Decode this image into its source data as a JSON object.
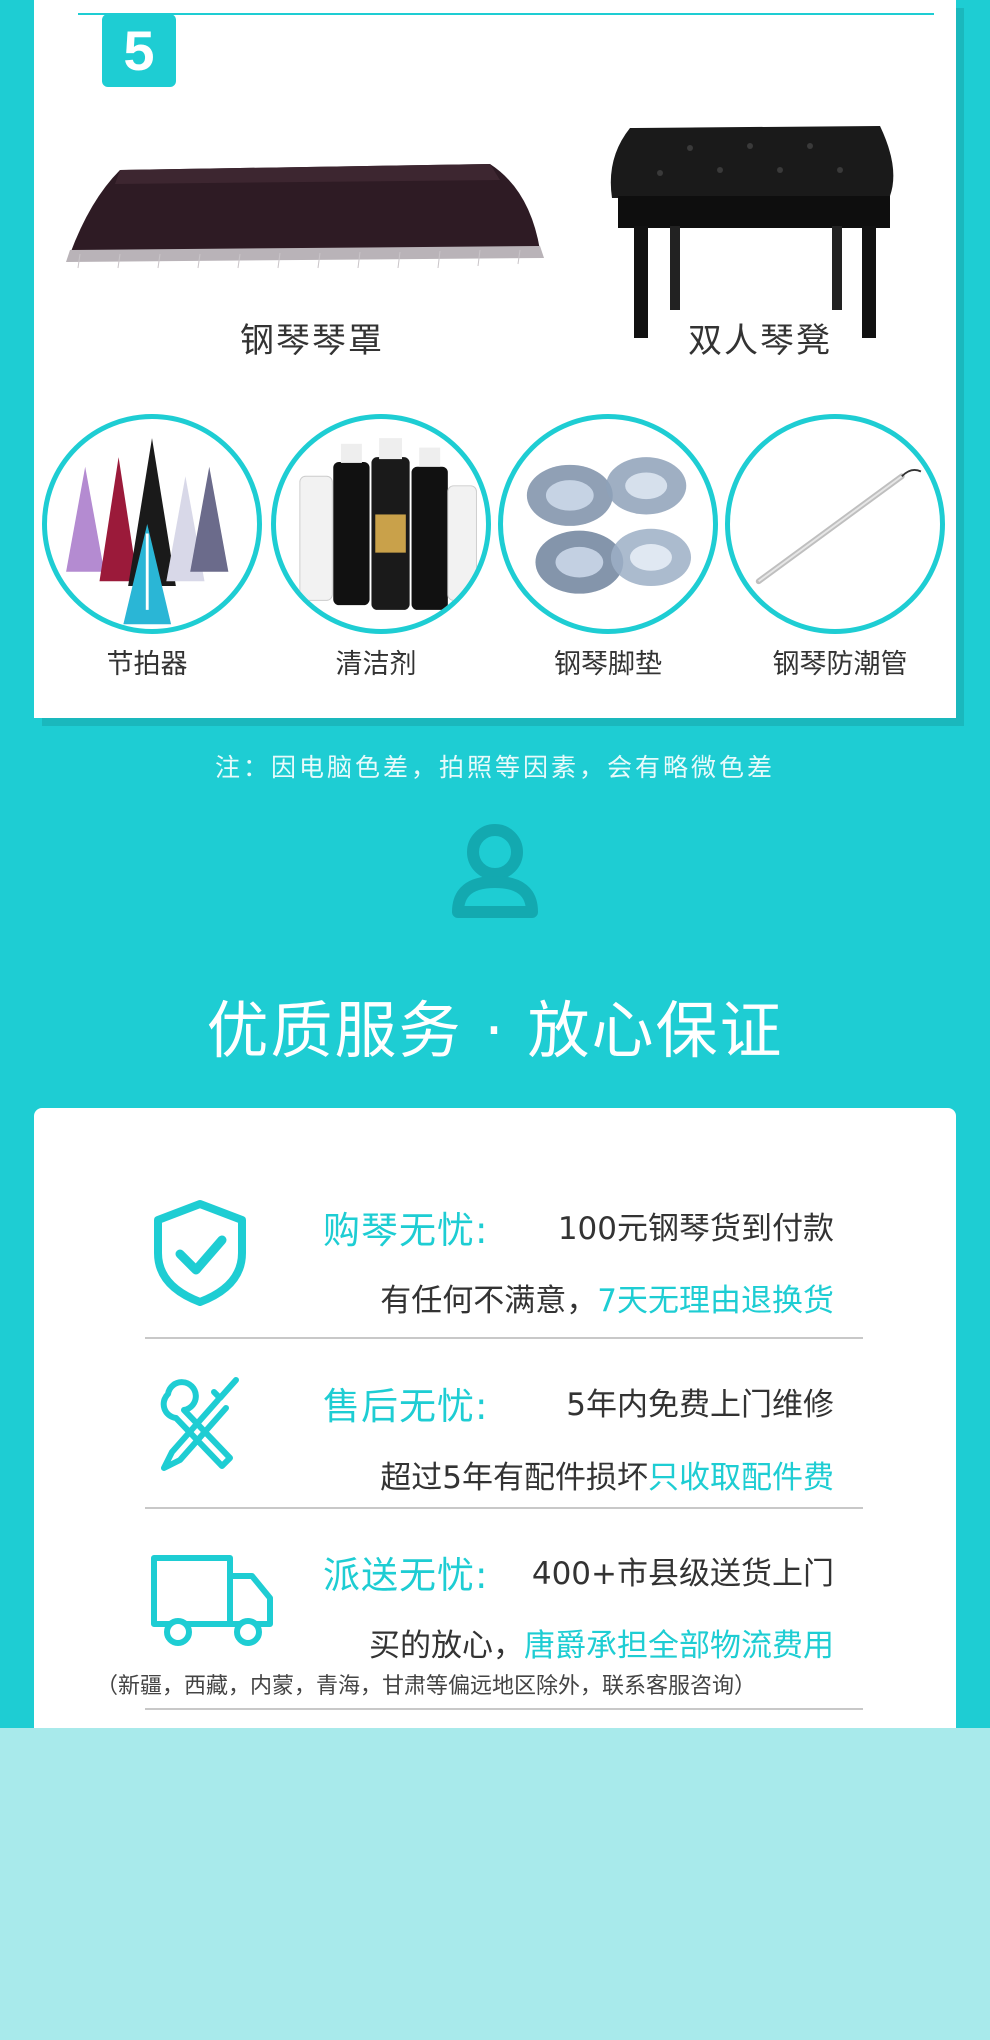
{
  "section_number": "5",
  "products": [
    {
      "label": "钢琴琴罩"
    },
    {
      "label": "双人琴凳"
    }
  ],
  "accessories": [
    {
      "label": "节拍器"
    },
    {
      "label": "清洁剂"
    },
    {
      "label": "钢琴脚垫"
    },
    {
      "label": "钢琴防潮管"
    }
  ],
  "note": "注：因电脑色差，拍照等因素，会有略微色差",
  "heading": "优质服务 · 放心保证",
  "services": [
    {
      "title": "购琴无忧:",
      "line1": "100元钢琴货到付款",
      "line2_plain": "有任何不满意，",
      "line2_highlight": "7天无理由退换货"
    },
    {
      "title": "售后无忧:",
      "line1": "5年内免费上门维修",
      "line2_plain": "超过5年有配件损坏",
      "line2_highlight": "只收取配件费"
    },
    {
      "title": "派送无忧:",
      "line1": "400+市县级送货上门",
      "line2_plain": "买的放心，",
      "line2_highlight": "唐爵承担全部物流费用"
    }
  ],
  "delivery_note": "（新疆，西藏，内蒙，青海，甘肃等偏远地区除外，联系客服咨询）",
  "colors": {
    "accent": "#1ecdd3",
    "bottom_panel": "#a8eaeb"
  },
  "icons": [
    "shield-check-icon",
    "tools-icon",
    "truck-icon",
    "person-icon"
  ]
}
